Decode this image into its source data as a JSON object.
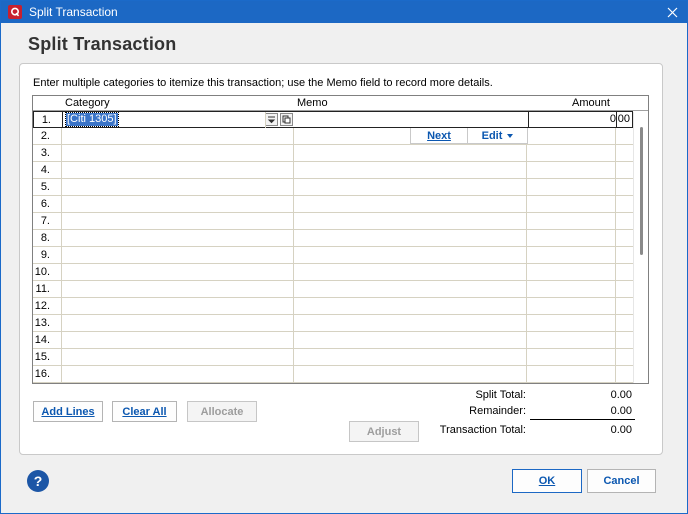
{
  "window": {
    "title": "Split Transaction",
    "app_icon": "quicken-q-icon",
    "close_icon": "close-icon"
  },
  "heading": "Split Transaction",
  "instructions": "Enter multiple categories to itemize this transaction; use the Memo field to record more details.",
  "grid": {
    "columns": {
      "category": "Category",
      "memo": "Memo",
      "amount": "Amount"
    },
    "row_numbers": [
      "1.",
      "2.",
      "3.",
      "4.",
      "5.",
      "6.",
      "7.",
      "8.",
      "9.",
      "10.",
      "11.",
      "12.",
      "13.",
      "14.",
      "15.",
      "16."
    ],
    "active_row": {
      "category": "[Citi 1305]",
      "amount_int": "0",
      "amount_dec": "00",
      "category_list_icon": "dropdown-list-icon",
      "category_details_icon": "details-icon"
    },
    "row_tools": {
      "next": "Next",
      "edit": "Edit"
    }
  },
  "buttons": {
    "add_lines": "Add Lines",
    "clear_all": "Clear All",
    "allocate": "Allocate",
    "adjust": "Adjust",
    "ok": "OK",
    "cancel": "Cancel",
    "help": "?"
  },
  "totals": {
    "split_total_label": "Split Total:",
    "split_total_value": "0.00",
    "remainder_label": "Remainder:",
    "remainder_value": "0.00",
    "transaction_total_label": "Transaction Total:",
    "transaction_total_value": "0.00"
  },
  "colors": {
    "titlebar": "#1c68c4",
    "link_blue": "#0b57b0",
    "selection": "#3a74c8"
  }
}
